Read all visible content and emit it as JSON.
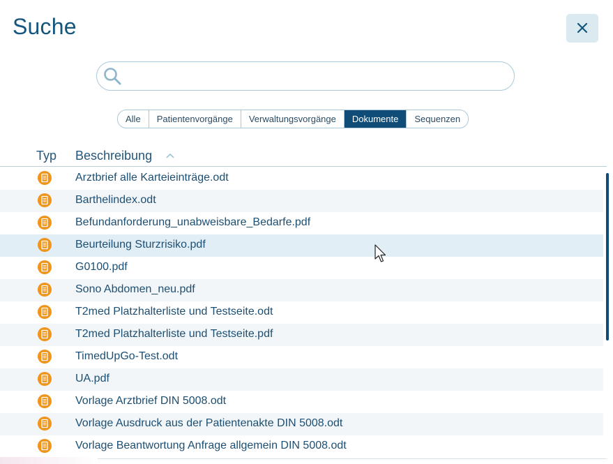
{
  "dialog": {
    "title": "Suche",
    "close_icon": "close-icon"
  },
  "search": {
    "value": "",
    "placeholder": "",
    "icon": "search-icon"
  },
  "filter_tabs": [
    {
      "label": "Alle",
      "active": false
    },
    {
      "label": "Patientenvorgänge",
      "active": false
    },
    {
      "label": "Verwaltungsvorgänge",
      "active": false
    },
    {
      "label": "Dokumente",
      "active": true
    },
    {
      "label": "Sequenzen",
      "active": false
    }
  ],
  "table": {
    "columns": {
      "typ": "Typ",
      "beschreibung": "Beschreibung",
      "sort": "ascending"
    },
    "rows": [
      {
        "icon": "document-icon",
        "label": "Arztbrief alle Karteieinträge.odt"
      },
      {
        "icon": "document-icon",
        "label": "Barthelindex.odt"
      },
      {
        "icon": "document-icon",
        "label": "Befundanforderung_unabweisbare_Bedarfe.pdf"
      },
      {
        "icon": "document-icon",
        "label": "Beurteilung Sturzrisiko.pdf"
      },
      {
        "icon": "document-icon",
        "label": "G0100.pdf"
      },
      {
        "icon": "document-icon",
        "label": "Sono Abdomen_neu.pdf"
      },
      {
        "icon": "document-icon",
        "label": "T2med Platzhalterliste und Testseite.odt"
      },
      {
        "icon": "document-icon",
        "label": "T2med Platzhalterliste und Testseite.pdf"
      },
      {
        "icon": "document-icon",
        "label": "TimedUpGo-Test.odt"
      },
      {
        "icon": "document-icon",
        "label": "UA.pdf"
      },
      {
        "icon": "document-icon",
        "label": "Vorlage Arztbrief DIN 5008.odt"
      },
      {
        "icon": "document-icon",
        "label": "Vorlage Ausdruck aus der Patientenakte DIN 5008.odt"
      },
      {
        "icon": "document-icon",
        "label": "Vorlage Beantwortung Anfrage allgemein DIN 5008.odt"
      }
    ]
  },
  "colors": {
    "accent": "#0f4d78",
    "title": "#14567e",
    "doc_icon": "#f0951b",
    "row_alt": "#f2f6f8",
    "row_hover": "#e2eef5"
  }
}
